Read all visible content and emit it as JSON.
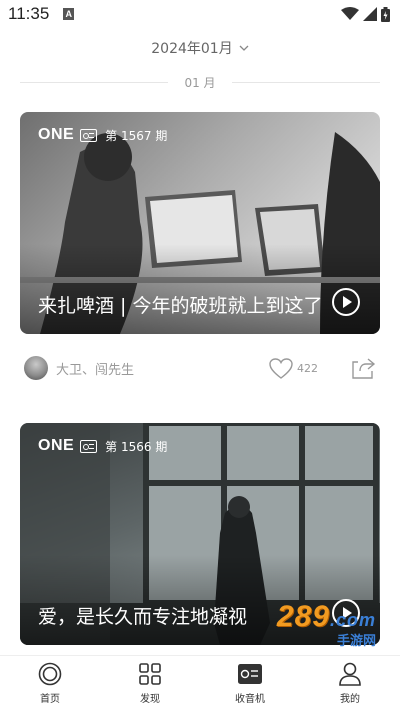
{
  "status_bar": {
    "time": "11:35",
    "notification_badge": "A"
  },
  "header": {
    "month_label": "2024年01月",
    "section_label": "01 月"
  },
  "cards": [
    {
      "brand": "ONE",
      "issue": "第 1567 期",
      "title": "来扎啤酒 | 今年的破班就上到这了"
    },
    {
      "brand": "ONE",
      "issue": "第 1566 期",
      "title": "爱，是长久而专注地凝视"
    }
  ],
  "meta": {
    "authors": "大卫、闯先生",
    "like_count": "422"
  },
  "tabs": [
    {
      "label": "首页",
      "icon": "home-icon"
    },
    {
      "label": "发现",
      "icon": "grid-icon"
    },
    {
      "label": "收音机",
      "icon": "radio-icon"
    },
    {
      "label": "我的",
      "icon": "profile-icon"
    }
  ],
  "watermark": {
    "number": "289",
    "suffix": ".com",
    "text": "手游网"
  },
  "colors": {
    "watermark_orange": "#f29b21",
    "watermark_blue": "#3a7fd6",
    "tab_icon": "#333333"
  }
}
